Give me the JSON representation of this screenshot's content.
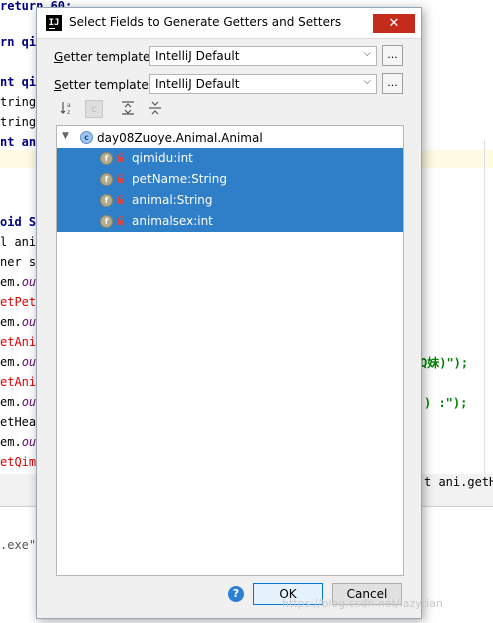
{
  "background_editor": {
    "lines": [
      {
        "segments": [
          {
            "t": "return 60;",
            "c": "kw"
          }
        ]
      },
      {
        "segments": [
          {
            "t": "rn qim",
            "c": "kw"
          }
        ]
      },
      {
        "segments": [
          {
            "t": "nt qi",
            "c": "kw"
          }
        ]
      },
      {
        "segments": [
          {
            "t": "tring",
            "c": ""
          }
        ]
      },
      {
        "segments": [
          {
            "t": "tring",
            "c": ""
          }
        ]
      },
      {
        "segments": [
          {
            "t": "nt an",
            "c": "kw"
          }
        ]
      },
      {
        "segments": [
          {
            "t": "oid S",
            "c": "kw"
          }
        ]
      },
      {
        "segments": [
          {
            "t": "l ani",
            "c": ""
          }
        ]
      },
      {
        "segments": [
          {
            "t": "ner sc",
            "c": ""
          }
        ]
      },
      {
        "segments": [
          {
            "t": "em.",
            "c": ""
          },
          {
            "t": "out",
            "c": "it"
          }
        ]
      },
      {
        "segments": [
          {
            "t": "etPet",
            "c": "rd"
          }
        ]
      },
      {
        "segments": [
          {
            "t": "em.",
            "c": ""
          },
          {
            "t": "out",
            "c": "it"
          }
        ]
      },
      {
        "segments": [
          {
            "t": "etAni",
            "c": "rd"
          }
        ]
      },
      {
        "segments": [
          {
            "t": "em.",
            "c": ""
          },
          {
            "t": "out",
            "c": "it"
          }
        ]
      },
      {
        "segments": [
          {
            "t": "etAni",
            "c": "rd"
          }
        ]
      },
      {
        "segments": [
          {
            "t": "em.",
            "c": ""
          },
          {
            "t": "out",
            "c": "it"
          }
        ]
      },
      {
        "segments": [
          {
            "t": "etHea",
            "c": ""
          }
        ]
      },
      {
        "segments": [
          {
            "t": "em.",
            "c": ""
          },
          {
            "t": "out",
            "c": "it"
          }
        ]
      },
      {
        "segments": [
          {
            "t": "etQim",
            "c": "rd"
          }
        ]
      },
      {
        "segments": [
          {
            "t": "em.",
            "c": ""
          },
          {
            "t": "out",
            "c": "it"
          }
        ]
      }
    ],
    "right_fragments": {
      "line1": "Q妹)\");",
      "line2": ") :\");",
      "line3": "t ani.getH"
    },
    "run_output": ".exe\""
  },
  "dialog": {
    "title": "Select Fields to Generate Getters and Setters",
    "close_glyph": "✕",
    "getter": {
      "label_mnemonic": "G",
      "label_rest": "etter template:",
      "value": "IntelliJ Default",
      "browse_label": "..."
    },
    "setter": {
      "label_mnemonic": "S",
      "label_rest": "etter template:",
      "value": "IntelliJ Default",
      "browse_label": "..."
    },
    "toolbar": {
      "sort_icon": "sort-alpha-icon",
      "expand_icon": "expand-all-icon",
      "collapse_icon": "collapse-all-icon"
    },
    "tree": {
      "root_label": "day08Zuoye.Animal.Animal",
      "root_icon_letter": "c",
      "fields": [
        {
          "label": "qimidu:int",
          "icon_letter": "f"
        },
        {
          "label": "petName:String",
          "icon_letter": "f"
        },
        {
          "label": "animal:String",
          "icon_letter": "f"
        },
        {
          "label": "animalsex:int",
          "icon_letter": "f"
        }
      ]
    },
    "help_label": "?",
    "ok_label": "OK",
    "cancel_label": "Cancel"
  },
  "watermark": "https://blog.csdn.net/lazytian",
  "colors": {
    "selection": "#2e7ec8",
    "close_button": "#c42b1c",
    "ok_border": "#0078d7"
  }
}
